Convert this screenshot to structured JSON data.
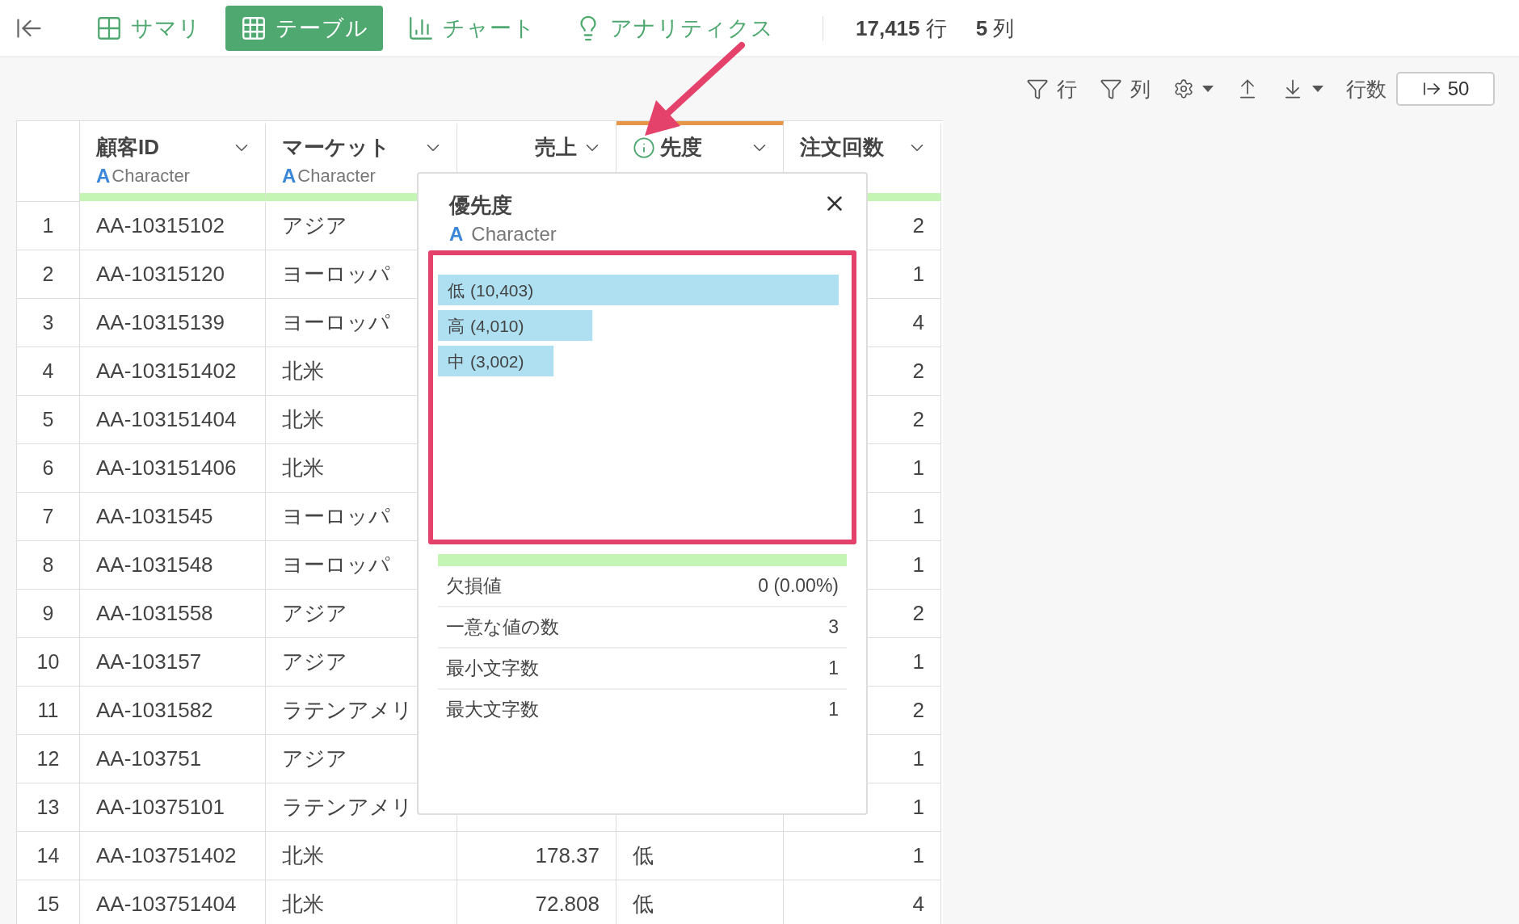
{
  "tabs": [
    {
      "label": "サマリ",
      "kind": "summary",
      "selected": false
    },
    {
      "label": "テーブル",
      "kind": "table",
      "selected": true
    },
    {
      "label": "チャート",
      "kind": "chart",
      "selected": false
    },
    {
      "label": "アナリティクス",
      "kind": "analytics",
      "selected": false
    }
  ],
  "counts": [
    {
      "value": "17,415",
      "unit": "行"
    },
    {
      "value": "5",
      "unit": "列"
    }
  ],
  "toolbar": {
    "row_filter": "行",
    "column_filter": "列",
    "rows_label": "行数",
    "rows_value": "50"
  },
  "columns": [
    {
      "name": "顧客ID",
      "kind": "text",
      "type_icon": "A",
      "type": "Character",
      "selected": false
    },
    {
      "name": "マーケット",
      "kind": "text",
      "type_icon": "A",
      "type": "Character",
      "selected": false
    },
    {
      "name": "売上",
      "kind": "numeric",
      "selected": false
    },
    {
      "name": "先度",
      "kind": "text",
      "info": true,
      "selected": true
    },
    {
      "name": "注文回数",
      "kind": "numeric",
      "selected": false
    }
  ],
  "rows": [
    {
      "no": "1",
      "cells": [
        "AA-10315102",
        "アジア",
        null,
        null,
        "2"
      ]
    },
    {
      "no": "2",
      "cells": [
        "AA-10315120",
        "ヨーロッパ",
        null,
        null,
        "1"
      ]
    },
    {
      "no": "3",
      "cells": [
        "AA-10315139",
        "ヨーロッパ",
        null,
        null,
        "4"
      ]
    },
    {
      "no": "4",
      "cells": [
        "AA-103151402",
        "北米",
        null,
        null,
        "2"
      ]
    },
    {
      "no": "5",
      "cells": [
        "AA-103151404",
        "北米",
        null,
        null,
        "2"
      ]
    },
    {
      "no": "6",
      "cells": [
        "AA-103151406",
        "北米",
        null,
        null,
        "1"
      ]
    },
    {
      "no": "7",
      "cells": [
        "AA-1031545",
        "ヨーロッパ",
        null,
        null,
        "1"
      ]
    },
    {
      "no": "8",
      "cells": [
        "AA-1031548",
        "ヨーロッパ",
        null,
        null,
        "1"
      ]
    },
    {
      "no": "9",
      "cells": [
        "AA-1031558",
        "アジア",
        null,
        null,
        "2"
      ]
    },
    {
      "no": "10",
      "cells": [
        "AA-103157",
        "アジア",
        null,
        null,
        "1"
      ]
    },
    {
      "no": "11",
      "cells": [
        "AA-1031582",
        "ラテンアメリ",
        null,
        null,
        "2"
      ]
    },
    {
      "no": "12",
      "cells": [
        "AA-103751",
        "アジア",
        null,
        null,
        "1"
      ]
    },
    {
      "no": "13",
      "cells": [
        "AA-10375101",
        "ラテンアメリ",
        null,
        null,
        "1"
      ]
    },
    {
      "no": "14",
      "cells": [
        "AA-103751402",
        "北米",
        "178.37",
        "低",
        "1"
      ]
    },
    {
      "no": "15",
      "cells": [
        "AA-103751404",
        "北米",
        "72.808",
        "低",
        "4"
      ]
    }
  ],
  "popup": {
    "title": "優先度",
    "type_icon": "A",
    "type": "Character",
    "chart_data": {
      "type": "bar",
      "orientation": "horizontal",
      "categories": [
        "低",
        "高",
        "中"
      ],
      "values": [
        10403,
        4010,
        3002
      ],
      "value_labels": [
        "(10,403)",
        "(4,010)",
        "(3,002)"
      ]
    },
    "completeness": {
      "level": 1
    },
    "stats": [
      {
        "label": "欠損値",
        "value": "0 (0.00%)"
      },
      {
        "label": "一意な値の数",
        "value": "3"
      },
      {
        "label": "最小文字数",
        "value": "1"
      },
      {
        "label": "最大文字数",
        "value": "1"
      }
    ]
  }
}
